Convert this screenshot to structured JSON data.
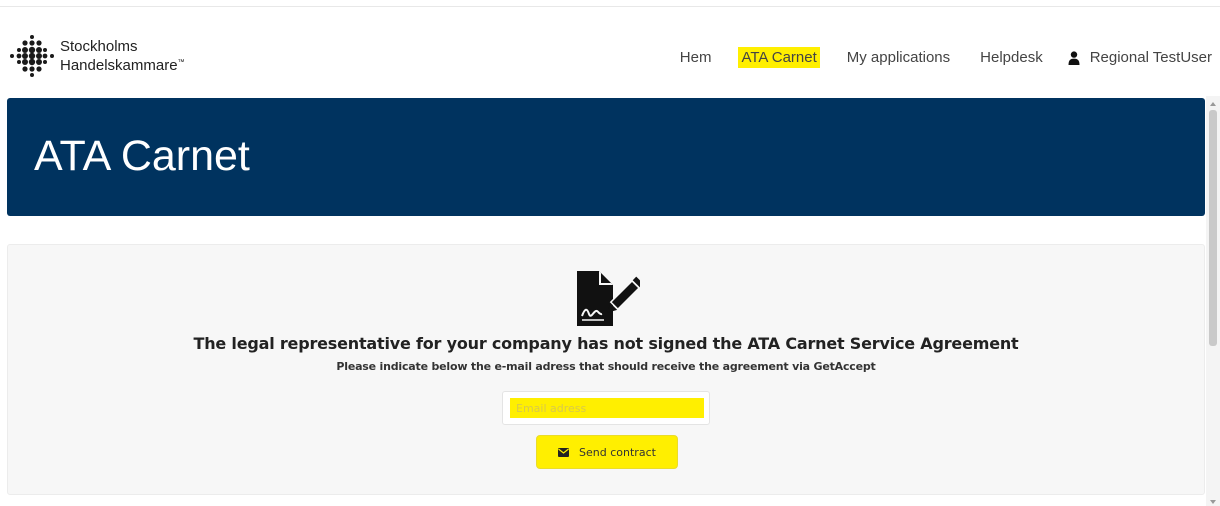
{
  "header": {
    "logo": {
      "line1": "Stockholms",
      "line2": "Handelskammare",
      "trademark": "™"
    },
    "nav": [
      {
        "label": "Hem",
        "active": false
      },
      {
        "label": "ATA Carnet",
        "active": true
      },
      {
        "label": "My applications",
        "active": false
      },
      {
        "label": "Helpdesk",
        "active": false
      }
    ],
    "user": {
      "label": "Regional TestUser",
      "icon": "user-icon"
    }
  },
  "banner": {
    "title": "ATA Carnet",
    "color": "#00335f"
  },
  "main": {
    "icon": "signed-document-icon",
    "headline": "The legal representative for your company has not signed the ATA Carnet Service Agreement",
    "subline": "Please indicate below the e-mail adress that should receive the agreement via GetAccept",
    "email": {
      "value": "",
      "placeholder": "Email adress"
    },
    "send_button": {
      "label": "Send contract",
      "icon": "envelope-icon"
    }
  },
  "colors": {
    "highlight": "#ffef00",
    "panel_bg": "#f7f7f7"
  }
}
